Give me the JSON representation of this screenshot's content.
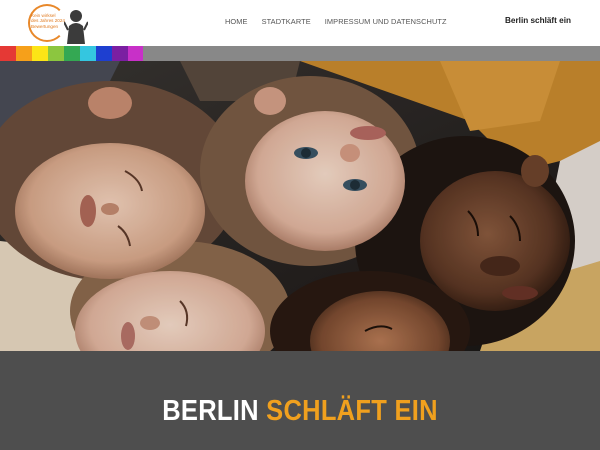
{
  "logo": {
    "line1": "Kein wirksel",
    "line2": "des Jahres 2024",
    "line3": "Bewertungen",
    "colors": {
      "ring": "#e8882a",
      "text": "#e07a1f",
      "figure": "#3b3b3b"
    }
  },
  "nav": {
    "items": [
      {
        "label": "HOME"
      },
      {
        "label": "STADTKARTE"
      },
      {
        "label": "IMPRESSUM UND DATENSCHUTZ"
      }
    ]
  },
  "brand": {
    "label": "Berlin schläft ein"
  },
  "color_strip": {
    "colors": [
      "#e53935",
      "#f6a01a",
      "#fce516",
      "#8cc63f",
      "#34a853",
      "#34c6e0",
      "#1e3fd0",
      "#7b1fa2",
      "#c830c8"
    ]
  },
  "hero": {
    "image": "children-sleeping-heads-together-photo"
  },
  "band": {
    "title_part1": "BERLIN",
    "title_part2": "SCHLÄFT EIN",
    "colors": {
      "background": "#4e4e4e",
      "part1": "#ffffff",
      "part2": "#f0a01e"
    }
  }
}
